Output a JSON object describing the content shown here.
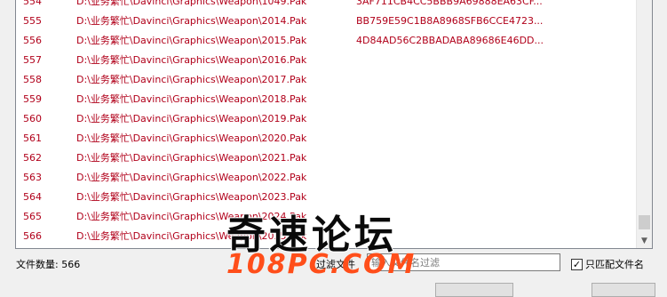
{
  "rows": [
    {
      "num": "554",
      "path": "D:\\业务繁忙\\Davinci\\Graphics\\Weapon\\1049.Pak",
      "hash": "3AF711CB4CC5BBB9A69888EA63CF..."
    },
    {
      "num": "555",
      "path": "D:\\业务繁忙\\Davinci\\Graphics\\Weapon\\2014.Pak",
      "hash": "BB759E59C1B8A8968SFB6CCE4723..."
    },
    {
      "num": "556",
      "path": "D:\\业务繁忙\\Davinci\\Graphics\\Weapon\\2015.Pak",
      "hash": "4D84AD56C2BBADABA89686E46DD..."
    },
    {
      "num": "557",
      "path": "D:\\业务繁忙\\Davinci\\Graphics\\Weapon\\2016.Pak",
      "hash": ""
    },
    {
      "num": "558",
      "path": "D:\\业务繁忙\\Davinci\\Graphics\\Weapon\\2017.Pak",
      "hash": ""
    },
    {
      "num": "559",
      "path": "D:\\业务繁忙\\Davinci\\Graphics\\Weapon\\2018.Pak",
      "hash": ""
    },
    {
      "num": "560",
      "path": "D:\\业务繁忙\\Davinci\\Graphics\\Weapon\\2019.Pak",
      "hash": ""
    },
    {
      "num": "561",
      "path": "D:\\业务繁忙\\Davinci\\Graphics\\Weapon\\2020.Pak",
      "hash": ""
    },
    {
      "num": "562",
      "path": "D:\\业务繁忙\\Davinci\\Graphics\\Weapon\\2021.Pak",
      "hash": ""
    },
    {
      "num": "563",
      "path": "D:\\业务繁忙\\Davinci\\Graphics\\Weapon\\2022.Pak",
      "hash": ""
    },
    {
      "num": "564",
      "path": "D:\\业务繁忙\\Davinci\\Graphics\\Weapon\\2023.Pak",
      "hash": ""
    },
    {
      "num": "565",
      "path": "D:\\业务繁忙\\Davinci\\Graphics\\Weapon\\2024.Pak",
      "hash": ""
    },
    {
      "num": "566",
      "path": "D:\\业务繁忙\\Davinci\\Graphics\\Weapon\\2025.Pak",
      "hash": ""
    }
  ],
  "footer": {
    "file_count": "文件数量: 566",
    "filter_label": "过滤文件",
    "filter_placeholder": "输入文件名过滤",
    "match_checked": true,
    "match_label": "只匹配文件名"
  },
  "watermark": {
    "top": "奇速论坛",
    "bottom": "108PC.COM"
  },
  "colors": {
    "row_text": "#b1001a",
    "watermark_orange": "#ff4e1a"
  },
  "icons": {
    "scroll_down": "triangle-down",
    "checkbox": "check-mark"
  }
}
